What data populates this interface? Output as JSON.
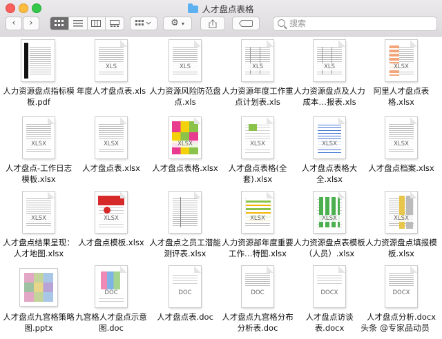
{
  "window": {
    "title": "人才盘点表格"
  },
  "toolbar": {
    "back": "‹",
    "forward": "›",
    "search_placeholder": "搜索",
    "views": [
      "icon-view",
      "list-view",
      "column-view",
      "gallery-view"
    ],
    "group_label": "group-by-menu",
    "action_label": "action-menu"
  },
  "files": [
    {
      "name": "人力资源盘点指标模板.pdf",
      "ext": "",
      "style": "pdf"
    },
    {
      "name": "年度人才盘点表.xls",
      "ext": "XLS",
      "style": "plain"
    },
    {
      "name": "人力资源风险防范盘点.xls",
      "ext": "XLS",
      "style": "plain"
    },
    {
      "name": "人力资源年度工作重点计划表.xls",
      "ext": "XLS",
      "style": "table"
    },
    {
      "name": "人力资源盘点及人力成本…报表.xls",
      "ext": "XLS",
      "style": "table"
    },
    {
      "name": "阿里人才盘点表格.xlsx",
      "ext": "XLSX",
      "style": "orange"
    },
    {
      "name": "人才盘点-工作日志模板.xlsx",
      "ext": "XLSX",
      "style": "plain"
    },
    {
      "name": "人才盘点表.xlsx",
      "ext": "XLSX",
      "style": "plain"
    },
    {
      "name": "人才盘点表格.xlsx",
      "ext": "XLSX",
      "style": "colorful"
    },
    {
      "name": "人才盘点表格(全套).xlsx",
      "ext": "XLSX",
      "style": "green-small"
    },
    {
      "name": "人才盘点表格大全.xlsx",
      "ext": "XLSX",
      "style": "blue-list"
    },
    {
      "name": "人才盘点档案.xlsx",
      "ext": "XLSX",
      "style": "plain"
    },
    {
      "name": "人才盘点结果呈现：人才地图.xlsx",
      "ext": "XLSX",
      "style": "plain"
    },
    {
      "name": "人才盘点模板.xlsx",
      "ext": "XLSX",
      "style": "red"
    },
    {
      "name": "人才盘点之员工潜能测评表.xlsx",
      "ext": "",
      "style": "dense"
    },
    {
      "name": "人力资源部年度重要工作…特图.xlsx",
      "ext": "XLSX",
      "style": "gantt"
    },
    {
      "name": "人力资源盘点表模板（人员）.xlsx",
      "ext": "XLSX",
      "style": "green"
    },
    {
      "name": "人力资源盘点填报模板.xlsx",
      "ext": "XLSX",
      "style": "yellow-grey"
    },
    {
      "name": "人才盘点九宫格策略图.pptx",
      "ext": "",
      "style": "pptx"
    },
    {
      "name": "九宫格人才盘点示意图.doc",
      "ext": "DOC",
      "style": "doc-color"
    },
    {
      "name": "人才盘点表.doc",
      "ext": "DOC",
      "style": "doc"
    },
    {
      "name": "人才盘点九宫格分布分析表.doc",
      "ext": "DOC",
      "style": "doc-table"
    },
    {
      "name": "人才盘点访谈表.docx",
      "ext": "DOCX",
      "style": "doc"
    },
    {
      "name": "人才盘点分析.docx",
      "ext": "DOCX",
      "style": "doc-table"
    }
  ],
  "watermark": "头条 @专家品动员"
}
